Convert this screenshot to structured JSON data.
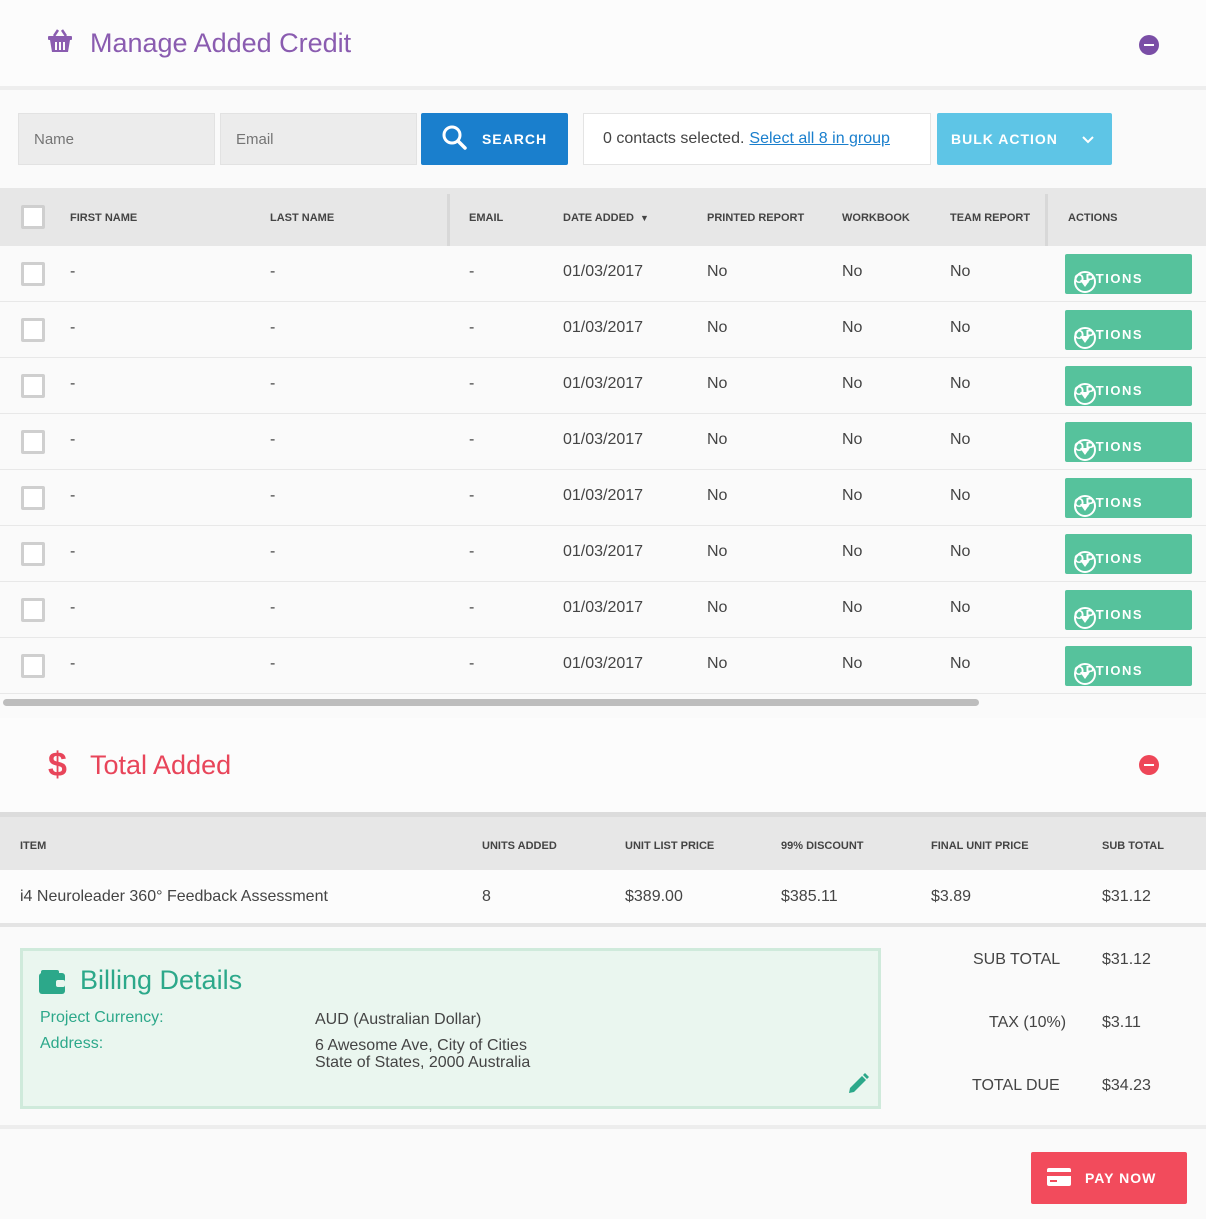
{
  "manage": {
    "title": "Manage Added Credit",
    "accent": "#8a5cb0"
  },
  "search": {
    "name_placeholder": "Name",
    "email_placeholder": "Email",
    "search_label": "SEARCH",
    "selected_text": "0 contacts selected.",
    "select_all_link": "Select all 8 in group",
    "bulk_label": "BULK ACTION"
  },
  "contacts_table": {
    "headers": {
      "first_name": "FIRST NAME",
      "last_name": "LAST NAME",
      "email": "EMAIL",
      "date_added": "DATE ADDED",
      "printed_report": "PRINTED REPORT",
      "workbook": "WORKBOOK",
      "team_report": "TEAM REPORT",
      "actions": "ACTIONS"
    },
    "rows": [
      {
        "first": "-",
        "last": "-",
        "email": "-",
        "date": "01/03/2017",
        "printed": "No",
        "workbook": "No",
        "team": "No",
        "action": "OPTIONS"
      },
      {
        "first": "-",
        "last": "-",
        "email": "-",
        "date": "01/03/2017",
        "printed": "No",
        "workbook": "No",
        "team": "No",
        "action": "OPTIONS"
      },
      {
        "first": "-",
        "last": "-",
        "email": "-",
        "date": "01/03/2017",
        "printed": "No",
        "workbook": "No",
        "team": "No",
        "action": "OPTIONS"
      },
      {
        "first": "-",
        "last": "-",
        "email": "-",
        "date": "01/03/2017",
        "printed": "No",
        "workbook": "No",
        "team": "No",
        "action": "OPTIONS"
      },
      {
        "first": "-",
        "last": "-",
        "email": "-",
        "date": "01/03/2017",
        "printed": "No",
        "workbook": "No",
        "team": "No",
        "action": "OPTIONS"
      },
      {
        "first": "-",
        "last": "-",
        "email": "-",
        "date": "01/03/2017",
        "printed": "No",
        "workbook": "No",
        "team": "No",
        "action": "OPTIONS"
      },
      {
        "first": "-",
        "last": "-",
        "email": "-",
        "date": "01/03/2017",
        "printed": "No",
        "workbook": "No",
        "team": "No",
        "action": "OPTIONS"
      },
      {
        "first": "-",
        "last": "-",
        "email": "-",
        "date": "01/03/2017",
        "printed": "No",
        "workbook": "No",
        "team": "No",
        "action": "OPTIONS"
      }
    ]
  },
  "total": {
    "icon_glyph": "$",
    "title": "Total Added",
    "accent": "#e8455a",
    "headers": {
      "item": "ITEM",
      "units": "UNITS ADDED",
      "unit_list": "UNIT LIST PRICE",
      "discount": "99% DISCOUNT",
      "final_unit": "FINAL UNIT PRICE",
      "sub_total": "SUB TOTAL"
    },
    "row": {
      "item": "i4 Neuroleader 360° Feedback Assessment",
      "units": "8",
      "unit_list": "$389.00",
      "discount": "$385.11",
      "final_unit": "$3.89",
      "sub_total": "$31.12"
    }
  },
  "billing": {
    "title": "Billing Details",
    "currency_label": "Project Currency:",
    "currency_value": "AUD (Australian Dollar)",
    "address_label": "Address:",
    "address_line1": "6 Awesome Ave, City of Cities",
    "address_line2": "State of States, 2000 Australia"
  },
  "summary": {
    "sub_total_label": "SUB TOTAL",
    "sub_total_value": "$31.12",
    "tax_label": "TAX (10%)",
    "tax_value": "$3.11",
    "total_due_label": "TOTAL DUE",
    "total_due_value": "$34.23"
  },
  "pay": {
    "label": "PAY NOW"
  }
}
